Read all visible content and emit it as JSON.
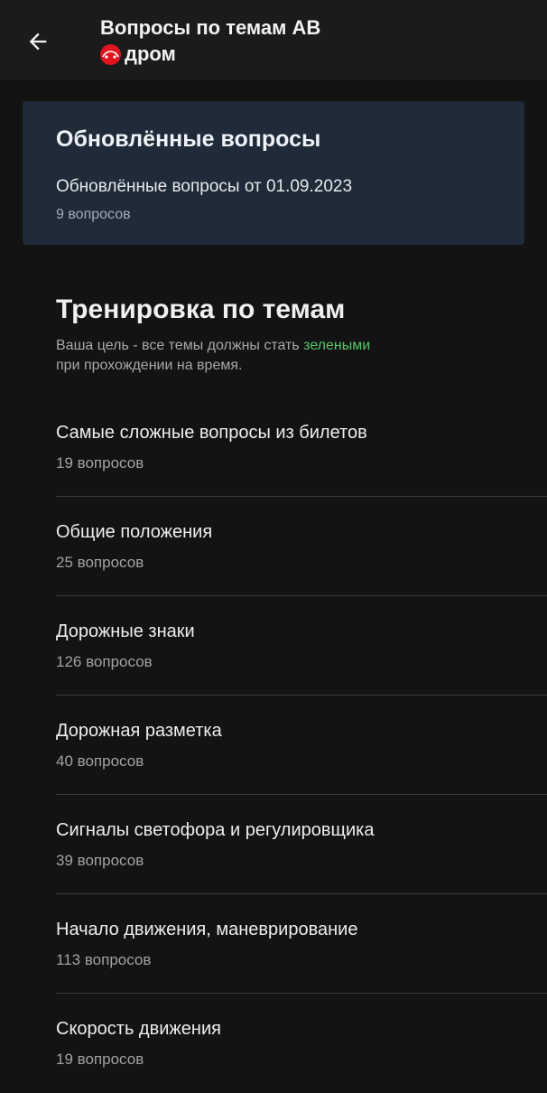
{
  "header": {
    "title": "Вопросы по темам АВ",
    "brand": "дром",
    "back_icon": "arrow-left-icon"
  },
  "updated_card": {
    "title": "Обновлённые вопросы",
    "description": "Обновлённые вопросы от 01.09.2023",
    "count": "9 вопросов"
  },
  "training": {
    "title": "Тренировка по темам",
    "subtitle_before": "Ваша цель - все темы должны стать ",
    "subtitle_highlight": "зелеными",
    "subtitle_after": "при прохождении на время.",
    "highlight_color": "#55c46a"
  },
  "topics": [
    {
      "title": "Самые сложные вопросы из билетов",
      "count": "19 вопросов"
    },
    {
      "title": "Общие положения",
      "count": "25 вопросов"
    },
    {
      "title": "Дорожные знаки",
      "count": "126 вопросов"
    },
    {
      "title": "Дорожная разметка",
      "count": "40 вопросов"
    },
    {
      "title": "Сигналы светофора и регулировщика",
      "count": "39 вопросов"
    },
    {
      "title": "Начало движения, маневрирование",
      "count": "113 вопросов"
    },
    {
      "title": "Скорость движения",
      "count": "19 вопросов"
    }
  ],
  "colors": {
    "background": "#131313",
    "topbar": "#1b1b1b",
    "card": "#1f2b38",
    "brand_red": "#e0141e"
  }
}
